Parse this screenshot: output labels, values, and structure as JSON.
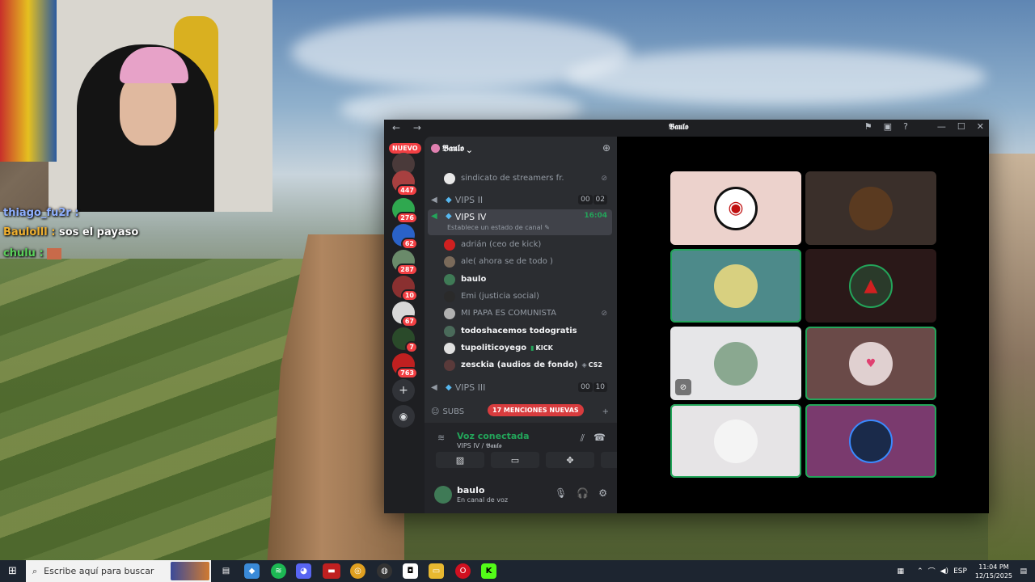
{
  "stream_overlay": {
    "chat": [
      {
        "user": "thiago_fu2r :",
        "message": ""
      },
      {
        "user": "Baulolll :",
        "message": "sos el payaso"
      },
      {
        "user": "chulu :",
        "message": ""
      }
    ]
  },
  "discord": {
    "window_title": "𝕭𝖆𝖚𝖑𝖔",
    "nav": "← →",
    "servers": {
      "nuevo_label": "NUEVO",
      "badges": [
        "447",
        "276",
        "62",
        "287",
        "10",
        "67",
        "7",
        "763"
      ]
    },
    "guild": {
      "name": "𝕭𝖆𝖚𝖑𝖔 ⌄"
    },
    "channels": {
      "top_partial": "sindicato de streamers fr.",
      "vips2": {
        "name": "VIPS II",
        "count_a": "00",
        "count_b": "02"
      },
      "vips4": {
        "name": "VIPS IV",
        "time": "16:04",
        "status": "Establece un estado de canal ✎"
      },
      "members": [
        {
          "name": "adrián (ceo de kick)",
          "bright": false
        },
        {
          "name": "ale( ahora se de todo )",
          "bright": false
        },
        {
          "name": "baulo",
          "bright": true
        },
        {
          "name": "Emi (justicia social)",
          "bright": false
        },
        {
          "name": "MI PAPA ES COMUNISTA",
          "bright": false
        },
        {
          "name": "todoshacemos todogratis",
          "bright": true
        },
        {
          "name": "tupoliticoyego",
          "bright": true,
          "tag": "KICK"
        },
        {
          "name": "zesckia (audios de fondo)",
          "bright": true,
          "tag": "CS2"
        }
      ],
      "vips3": {
        "name": "VIPS III",
        "count_a": "00",
        "count_b": "10"
      },
      "subs_label": "SUBS",
      "mentions_pill": "17 MENCIONES NUEVAS"
    },
    "voice_panel": {
      "status": "Voz conectada",
      "channel": "VIPS IV / 𝕭𝖆𝖚𝖑𝖔"
    },
    "user": {
      "name": "baulo",
      "status": "En canal de voz"
    }
  },
  "taskbar": {
    "search_placeholder": "Escribe aquí para buscar",
    "lang": "ESP",
    "time": "11:04 PM",
    "date": "12/15/2025"
  },
  "colors": {
    "discord_bg": "#1e1f22",
    "sidebar_bg": "#2b2d31",
    "speaking_green": "#23a55a",
    "mention_red": "#d83c3e"
  }
}
